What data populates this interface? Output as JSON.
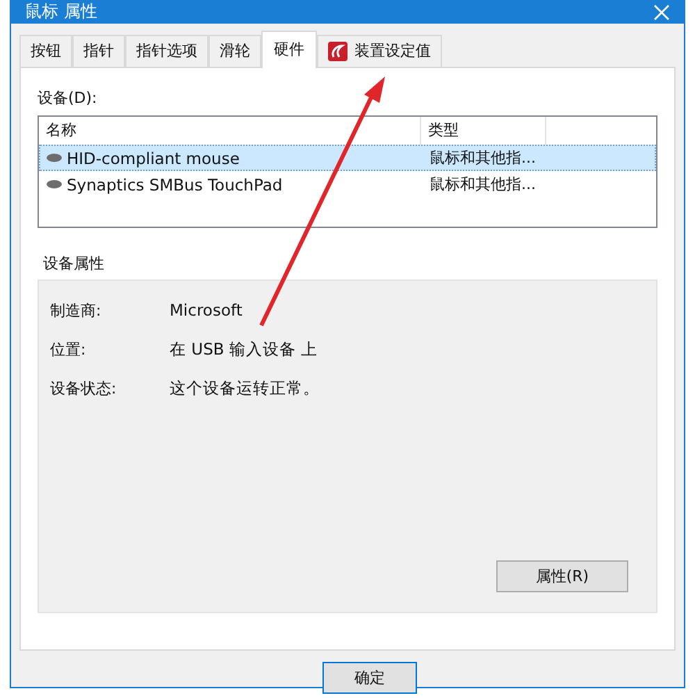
{
  "window": {
    "title": "鼠标 属性"
  },
  "tabs": [
    {
      "label": "按钮",
      "selected": false,
      "kind": "text"
    },
    {
      "label": "指针",
      "selected": false,
      "kind": "text"
    },
    {
      "label": "指针选项",
      "selected": false,
      "kind": "text"
    },
    {
      "label": "滑轮",
      "selected": false,
      "kind": "text"
    },
    {
      "label": "硬件",
      "selected": true,
      "kind": "text"
    },
    {
      "label": "装置设定值",
      "selected": false,
      "kind": "icon"
    }
  ],
  "devices": {
    "label": "设备(D):",
    "columns": [
      "名称",
      "类型"
    ],
    "rows": [
      {
        "name": "HID-compliant mouse",
        "type": "鼠标和其他指...",
        "selected": true
      },
      {
        "name": "Synaptics SMBus TouchPad",
        "type": "鼠标和其他指...",
        "selected": false
      }
    ]
  },
  "properties": {
    "title": "设备属性",
    "fields": [
      {
        "label": "制造商:",
        "value": "Microsoft"
      },
      {
        "label": "位置:",
        "value": "在 USB 输入设备 上"
      },
      {
        "label": "设备状态:",
        "value": "这个设备运转正常。"
      }
    ],
    "button": "属性(R)"
  },
  "buttons": [
    "确定"
  ]
}
